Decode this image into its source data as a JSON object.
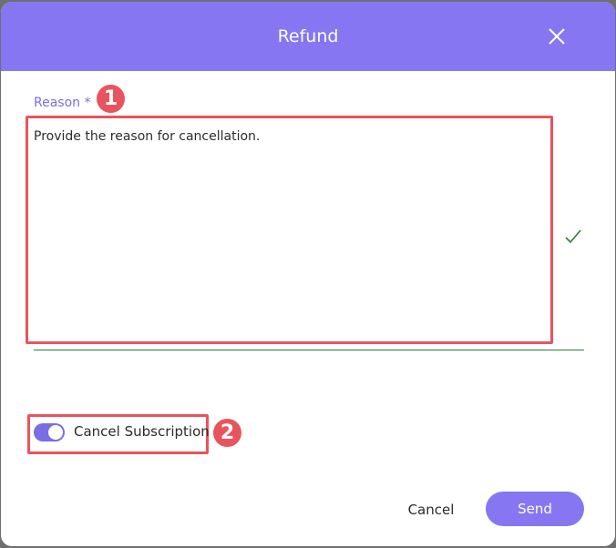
{
  "dialog": {
    "title": "Refund",
    "close_icon": "close-icon"
  },
  "form": {
    "reason_label": "Reason *",
    "reason_value": "Provide the reason for cancellation.",
    "valid_icon": "check-icon",
    "cancel_subscription_label": "Cancel Subscription",
    "cancel_subscription_on": true
  },
  "actions": {
    "cancel_label": "Cancel",
    "send_label": "Send"
  },
  "annotations": {
    "badge_1": "1",
    "badge_2": "2"
  },
  "colors": {
    "header": "#8676f2",
    "accent": "#7a6ee6",
    "annotation": "#e8545d",
    "valid": "#2d7c3f"
  }
}
